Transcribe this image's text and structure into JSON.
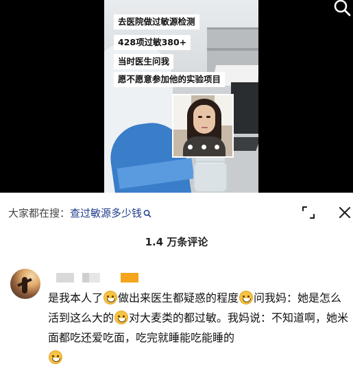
{
  "video": {
    "captions": [
      "去医院做过敏源检测",
      "428项过敏380+",
      "当时医生问我",
      "愿不愿意参加他的实验项目"
    ]
  },
  "search_suggestion": {
    "prefix": "大家都在搜：",
    "term": "查过敏源多少钱",
    "icon": "search-icon"
  },
  "comments_panel": {
    "count_label": "1.4 万条评论",
    "expand_icon": "expand-icon",
    "close_icon": "close-icon"
  },
  "comment": {
    "segments": [
      "是我本人了",
      "做出来医生都疑惑的程度",
      "问我妈：她是怎么活到这么大的",
      "对大麦类的都过敏。我妈说：不知道啊，她米面都吃还爱吃面，吃完就睡能吃能睡的"
    ],
    "emoji": "grinning-face"
  },
  "colors": {
    "suggest_term": "#1e3a8a",
    "caption_bg": "#ffffff",
    "video_bg": "#000000"
  }
}
